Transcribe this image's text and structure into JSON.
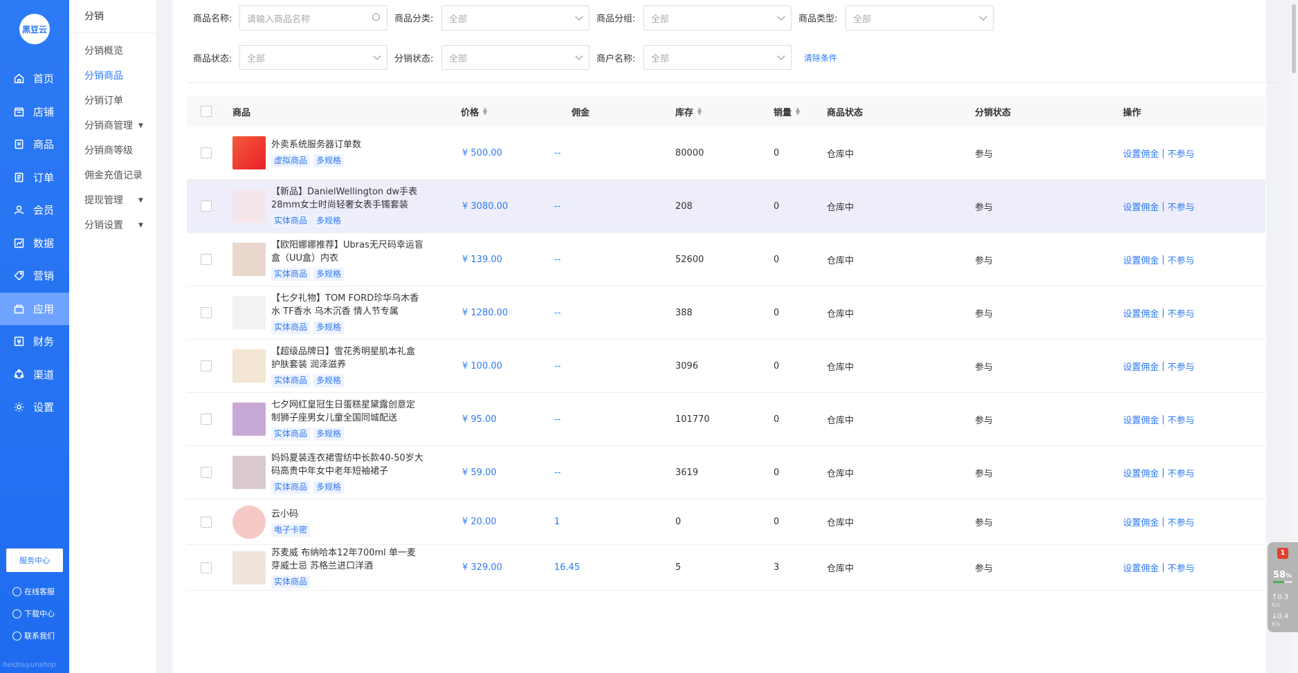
{
  "brand": {
    "logo_text": "黑豆云",
    "footer": "heidouyunshop"
  },
  "nav": {
    "items": [
      {
        "label": "首页",
        "icon": "home-icon"
      },
      {
        "label": "店铺",
        "icon": "shop-icon"
      },
      {
        "label": "商品",
        "icon": "goods-icon"
      },
      {
        "label": "订单",
        "icon": "order-icon"
      },
      {
        "label": "会员",
        "icon": "member-icon"
      },
      {
        "label": "数据",
        "icon": "chart-icon"
      },
      {
        "label": "营销",
        "icon": "tag-icon"
      },
      {
        "label": "应用",
        "icon": "app-icon"
      },
      {
        "label": "财务",
        "icon": "finance-icon"
      },
      {
        "label": "渠道",
        "icon": "channel-icon"
      },
      {
        "label": "设置",
        "icon": "gear-icon"
      }
    ],
    "service_button": "服务中心",
    "links": [
      "在线客服",
      "下载中心",
      "联系我们"
    ]
  },
  "subnav": {
    "title": "分销",
    "items": [
      "分销概览",
      "分销商品",
      "分销订单",
      "分销商管理",
      "分销商等级",
      "佣金充值记录",
      "提现管理",
      "分销设置"
    ]
  },
  "filters": {
    "name_label": "商品名称:",
    "name_placeholder": "请输入商品名称",
    "category_label": "商品分类:",
    "category_value": "全部",
    "group_label": "商品分组:",
    "group_value": "全部",
    "type_label": "商品类型:",
    "type_value": "全部",
    "status_label": "商品状态:",
    "status_value": "全部",
    "dist_status_label": "分销状态:",
    "dist_status_value": "全部",
    "merchant_label": "商户名称:",
    "merchant_value": "全部",
    "clear": "清除条件"
  },
  "table": {
    "headers": {
      "product": "商品",
      "price": "价格",
      "commission": "佣金",
      "stock": "库存",
      "sales": "销量",
      "status": "商品状态",
      "dist_status": "分销状态",
      "ops": "操作"
    },
    "op_set": "设置佣金",
    "op_sep": "|",
    "op_no": "不参与",
    "rows": [
      {
        "name": "外卖系统服务器订单数",
        "tags": [
          "虚拟商品",
          "多规格"
        ],
        "price": "¥ 500.00",
        "commission": "--",
        "stock": "80000",
        "sales": "0",
        "status": "仓库中",
        "dist": "参与"
      },
      {
        "name": "【新品】DanielWellington dw手表28mm女士时尚轻奢女表手镯套装",
        "tags": [
          "实体商品",
          "多规格"
        ],
        "price": "¥ 3080.00",
        "commission": "--",
        "stock": "208",
        "sales": "0",
        "status": "仓库中",
        "dist": "参与"
      },
      {
        "name": "【欧阳娜娜推荐】Ubras无尺码幸运盲盒（UU盒）内衣",
        "tags": [
          "实体商品",
          "多规格"
        ],
        "price": "¥ 139.00",
        "commission": "--",
        "stock": "52600",
        "sales": "0",
        "status": "仓库中",
        "dist": "参与"
      },
      {
        "name": "【七夕礼物】TOM FORD珍华乌木香水 TF香水 乌木沉香 情人节专属",
        "tags": [
          "实体商品",
          "多规格"
        ],
        "price": "¥ 1280.00",
        "commission": "--",
        "stock": "388",
        "sales": "0",
        "status": "仓库中",
        "dist": "参与"
      },
      {
        "name": "【超级品牌日】雪花秀明星肌本礼盒护肤套装 润泽滋养",
        "tags": [
          "实体商品",
          "多规格"
        ],
        "price": "¥ 100.00",
        "commission": "--",
        "stock": "3096",
        "sales": "0",
        "status": "仓库中",
        "dist": "参与"
      },
      {
        "name": "七夕网红皇冠生日蛋糕星黛露创意定制狮子座男女儿童全国同城配送",
        "tags": [
          "实体商品",
          "多规格"
        ],
        "price": "¥ 95.00",
        "commission": "--",
        "stock": "101770",
        "sales": "0",
        "status": "仓库中",
        "dist": "参与"
      },
      {
        "name": "妈妈夏装连衣裙雪纺中长款40-50岁大码高贵中年女中老年短袖裙子",
        "tags": [
          "实体商品",
          "多规格"
        ],
        "price": "¥ 59.00",
        "commission": "--",
        "stock": "3619",
        "sales": "0",
        "status": "仓库中",
        "dist": "参与"
      },
      {
        "name": "云小码",
        "tags": [
          "电子卡密"
        ],
        "price": "¥ 20.00",
        "commission": "1",
        "stock": "0",
        "sales": "0",
        "status": "仓库中",
        "dist": "参与"
      },
      {
        "name": "苏麦威 布纳哈本12年700ml 单一麦芽威士忌 苏格兰进口洋酒",
        "tags": [
          "实体商品"
        ],
        "price": "¥ 329.00",
        "commission": "16.45",
        "stock": "5",
        "sales": "3",
        "status": "仓库中",
        "dist": "参与"
      }
    ]
  },
  "widget": {
    "badge": "1",
    "pct": "58",
    "pct_unit": "%",
    "up": "0.3",
    "down": "0.4",
    "unit": "K/s"
  },
  "colors": {
    "accent": "#2d7af5",
    "nav_active": "#6fa3ff",
    "row_highlight": "#edeefa"
  }
}
